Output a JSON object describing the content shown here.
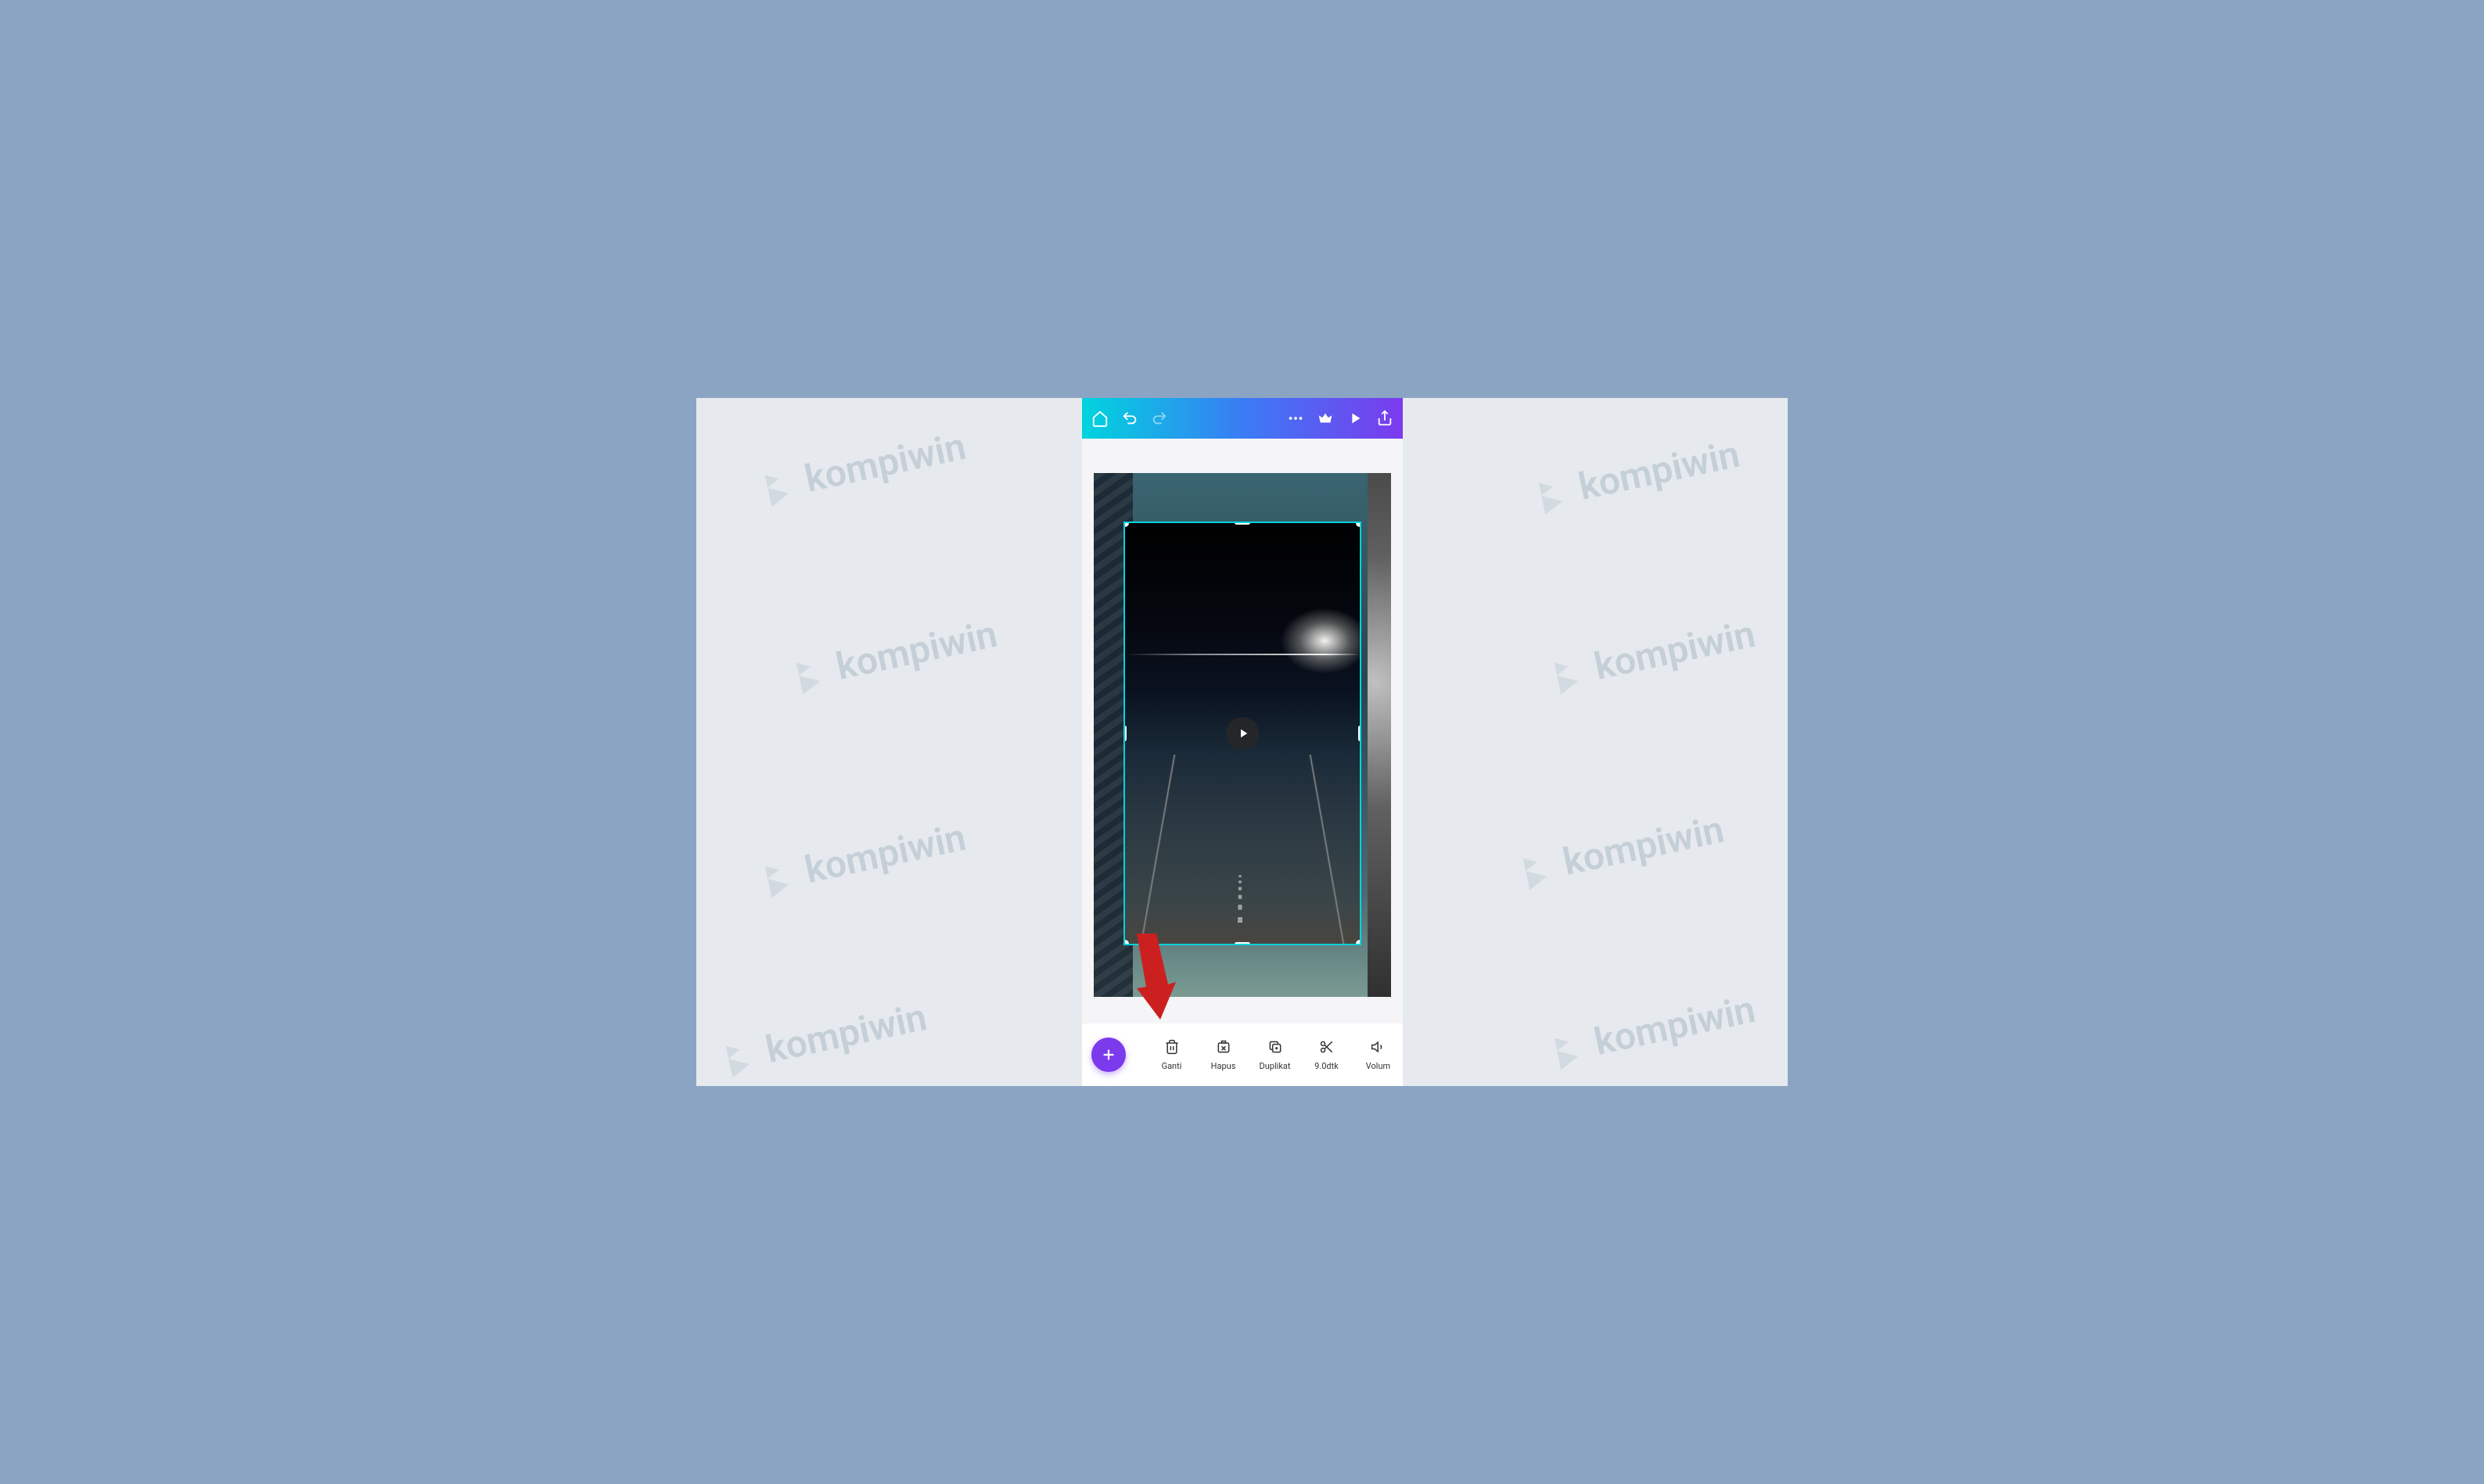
{
  "watermark_text": "kompiwin",
  "header": {
    "icons": [
      "home",
      "undo",
      "redo",
      "more",
      "crown",
      "play",
      "share"
    ]
  },
  "canvas": {
    "selection_active": true,
    "video_playing": false
  },
  "toolbar": {
    "add_label": "+",
    "items": [
      {
        "icon": "trash",
        "label": "Ganti"
      },
      {
        "icon": "delete",
        "label": "Hapus"
      },
      {
        "icon": "copy",
        "label": "Duplikat"
      },
      {
        "icon": "scissors",
        "label": "9.0dtk"
      },
      {
        "icon": "volume",
        "label": "Volum"
      }
    ]
  },
  "colors": {
    "gradient_start": "#00d4dd",
    "gradient_mid": "#3a7cf5",
    "gradient_end": "#7c3aed",
    "selection_border": "#00d4dd",
    "add_button": "#7c3aed"
  }
}
